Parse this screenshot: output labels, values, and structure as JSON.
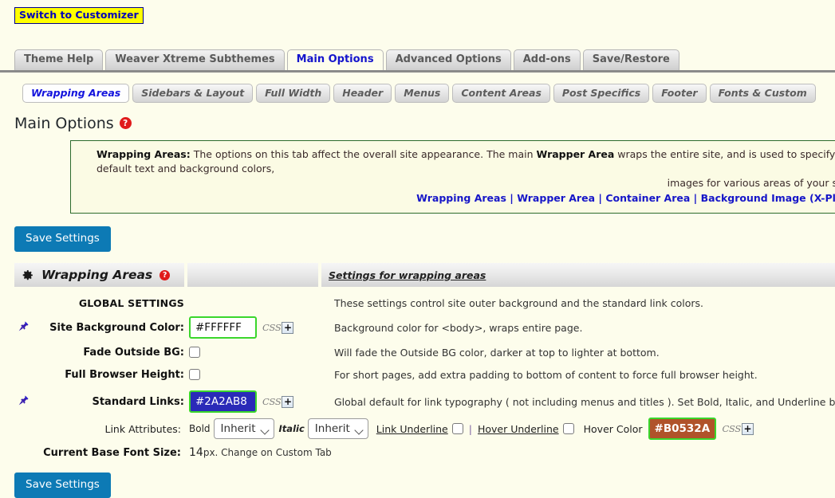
{
  "customizer": {
    "label": "Switch to Customizer"
  },
  "main_tabs": [
    {
      "label": "Theme Help",
      "active": false
    },
    {
      "label": "Weaver Xtreme Subthemes",
      "active": false
    },
    {
      "label": "Main Options",
      "active": true
    },
    {
      "label": "Advanced Options",
      "active": false
    },
    {
      "label": "Add-ons",
      "active": false
    },
    {
      "label": "Save/Restore",
      "active": false
    }
  ],
  "sub_tabs": [
    {
      "label": "Wrapping Areas",
      "active": true
    },
    {
      "label": "Sidebars & Layout",
      "active": false
    },
    {
      "label": "Full Width",
      "active": false
    },
    {
      "label": "Header",
      "active": false
    },
    {
      "label": "Menus",
      "active": false
    },
    {
      "label": "Content Areas",
      "active": false
    },
    {
      "label": "Post Specifics",
      "active": false
    },
    {
      "label": "Footer",
      "active": false
    },
    {
      "label": "Fonts & Custom",
      "active": false
    }
  ],
  "page_title": "Main Options",
  "help_badge": "?",
  "infobox": {
    "line1_prefix": "Wrapping Areas:",
    "line1_a": " The options on this tab affect the overall site appearance. The main ",
    "line1_bold": "Wrapper Area",
    "line1_b": " wraps the entire site, and is used to specify default text and background colors,",
    "line2": "images for various areas of your site.",
    "links": [
      "Wrapping Areas",
      "Wrapper Area",
      "Container Area",
      "Background Image (X-Plus)"
    ],
    "link_separator": "|"
  },
  "save_button_top": "Save Settings",
  "save_button_bottom": "Save Settings",
  "section": {
    "title": "Wrapping Areas",
    "gear_icon": "gear-icon",
    "right_header": "Settings for wrapping areas",
    "intro_desc": "These settings control site outer background and the standard link colors.",
    "global_settings_label": "GLOBAL SETTINGS"
  },
  "rows": [
    {
      "pin": "pin-icon",
      "label": "Site Background Color:",
      "value": "#FFFFFF",
      "css_label": "CSS",
      "css_plus": "+",
      "desc": "Background color for <body>, wraps entire page."
    },
    {
      "pin": "",
      "label": "Fade Outside BG:",
      "checked": false,
      "desc": "Will fade the Outside BG color, darker at top to lighter at bottom."
    },
    {
      "pin": "",
      "label": "Full Browser Height:",
      "checked": false,
      "desc": "For short pages, add extra padding to bottom of content to force full browser height."
    },
    {
      "pin": "pin-icon",
      "label": "Standard Links:",
      "value": "#2A2AB8",
      "css_label": "CSS",
      "css_plus": "+",
      "desc": "Global default for link typography ( not including menus and titles ). Set Bold, Italic, and Underline by setting those options for specific"
    }
  ],
  "link_attributes": {
    "label": "Link Attributes:",
    "bold_label": "Bold",
    "bold_value": "Inherit",
    "italic_label": "Italic",
    "italic_value": "Inherit",
    "link_underline_label": "Link Underline",
    "link_underline_checked": false,
    "separator": "|",
    "hover_underline_label": "Hover Underline",
    "hover_underline_checked": false,
    "hover_color_label": "Hover Color",
    "hover_color_value": "#B0532A",
    "css_label": "CSS",
    "css_plus": "+"
  },
  "base_font": {
    "label": "Current Base Font Size:",
    "value": "14",
    "note": "px. Change on Custom Tab"
  },
  "colors": {
    "page_bg": "#FDFDEC",
    "accent_blue": "#0D7AB5",
    "link_blue": "#1616C8",
    "field_border_green": "#3AD62C",
    "standard_link_swatch": "#2A2AB8",
    "hover_color_swatch": "#B0532A",
    "highlight_yellow": "#FFFF00",
    "help_red": "#E01B1B"
  }
}
